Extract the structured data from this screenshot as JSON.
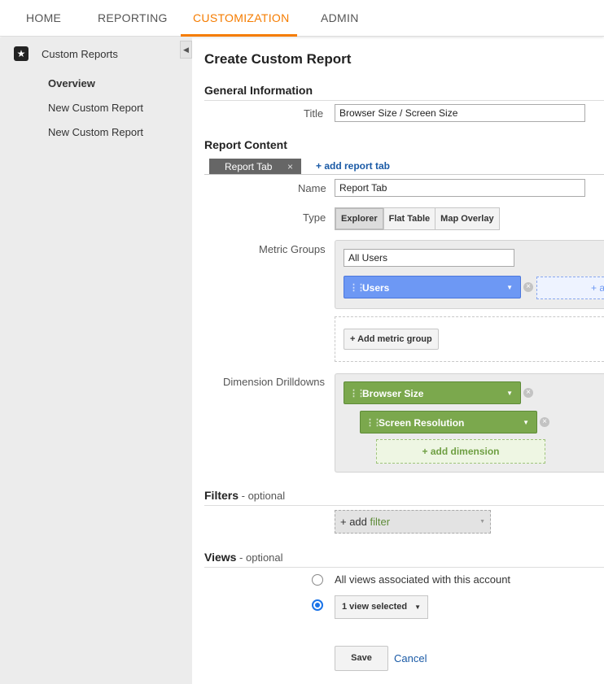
{
  "nav": {
    "tabs": [
      {
        "label": "HOME"
      },
      {
        "label": "REPORTING"
      },
      {
        "label": "CUSTOMIZATION"
      },
      {
        "label": "ADMIN"
      }
    ],
    "active_index": 2,
    "accent_color": "#f57c00"
  },
  "sidebar": {
    "title": "Custom Reports",
    "items": [
      {
        "label": "Overview"
      },
      {
        "label": "New Custom Report"
      },
      {
        "label": "New Custom Report"
      }
    ]
  },
  "page": {
    "title": "Create Custom Report"
  },
  "general": {
    "heading": "General Information",
    "title_label": "Title",
    "title_value": "Browser Size / Screen Size"
  },
  "content": {
    "heading": "Report Content",
    "tab_label": "Report Tab",
    "tab_close": "×",
    "add_tab": "+ add report tab",
    "name_label": "Name",
    "name_value": "Report Tab",
    "type_label": "Type",
    "types": [
      "Explorer",
      "Flat Table",
      "Map Overlay"
    ],
    "metric_groups_label": "Metric Groups",
    "metric_group_name": "All Users",
    "metric_chip": "Users",
    "add_metric_partial": "+ a",
    "add_metric_group": "+ Add metric group",
    "dimension_label": "Dimension Drilldowns",
    "dimensions": [
      "Browser Size",
      "Screen Resolution"
    ],
    "add_dimension": "+ add dimension"
  },
  "filters": {
    "heading": "Filters",
    "optional": " - optional",
    "add_prefix": "+ add ",
    "add_word": "filter"
  },
  "views": {
    "heading": "Views",
    "optional": " - optional",
    "option_all": "All views associated with this account",
    "selected_value": "1 view selected"
  },
  "actions": {
    "save": "Save",
    "cancel": "Cancel"
  }
}
